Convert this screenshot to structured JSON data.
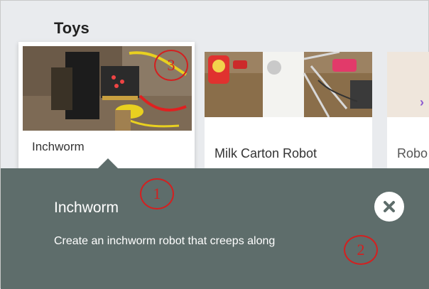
{
  "section": {
    "title": "Toys"
  },
  "cards": [
    {
      "label": "Inchworm",
      "selected": true
    },
    {
      "label": "Milk Carton Robot",
      "selected": false
    },
    {
      "label": "Robo",
      "selected": false
    }
  ],
  "carousel": {
    "next_icon": "chevron-right-icon",
    "arrow_glyph": "›"
  },
  "detail": {
    "title": "Inchworm",
    "description": "Create an inchworm robot that creeps along",
    "close_icon": "close-icon"
  },
  "annotations": [
    "1",
    "2",
    "3"
  ],
  "colors": {
    "panel": "#5e6d6b",
    "accent": "#8c5bd0",
    "annotation": "#d32020"
  }
}
